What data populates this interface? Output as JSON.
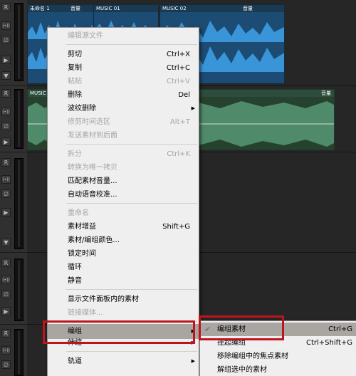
{
  "clips": {
    "clip1_name": "未命名 1",
    "clip1_vol": "音量",
    "clip2_name": "MUSIC 01",
    "clip2_vol": "音量",
    "clip3_name": "MUSIC 02",
    "clip3_vol": "音量",
    "clip4_name": "MUSIC",
    "clip4_vol": "音量"
  },
  "track_buttons": {
    "r": "R",
    "ro": "(•))",
    "phase": "∅"
  },
  "context_menu": {
    "items": [
      {
        "label": "编辑源文件",
        "shortcut": "",
        "disabled": true
      },
      {
        "label": "剪切",
        "shortcut": "Ctrl+X",
        "disabled": false
      },
      {
        "label": "复制",
        "shortcut": "Ctrl+C",
        "disabled": false
      },
      {
        "label": "粘贴",
        "shortcut": "Ctrl+V",
        "disabled": true
      },
      {
        "label": "删除",
        "shortcut": "Del",
        "disabled": false
      },
      {
        "label": "波纹删除",
        "shortcut": "",
        "disabled": false,
        "submenu": true
      },
      {
        "label": "修剪时间选区",
        "shortcut": "Alt+T",
        "disabled": true
      },
      {
        "label": "发送素材到后面",
        "shortcut": "",
        "disabled": true
      },
      {
        "label": "拆分",
        "shortcut": "Ctrl+K",
        "disabled": true
      },
      {
        "label": "转换为唯一拷贝",
        "shortcut": "",
        "disabled": true
      },
      {
        "label": "匹配素材音量...",
        "shortcut": "",
        "disabled": false
      },
      {
        "label": "自动语音校准...",
        "shortcut": "",
        "disabled": false
      },
      {
        "label": "重命名",
        "shortcut": "",
        "disabled": true
      },
      {
        "label": "素材增益",
        "shortcut": "Shift+G",
        "disabled": false
      },
      {
        "label": "素材/编组颜色...",
        "shortcut": "",
        "disabled": false
      },
      {
        "label": "锁定时间",
        "shortcut": "",
        "disabled": false
      },
      {
        "label": "循环",
        "shortcut": "",
        "disabled": false
      },
      {
        "label": "静音",
        "shortcut": "",
        "disabled": false
      },
      {
        "label": "显示文件面板内的素材",
        "shortcut": "",
        "disabled": false
      },
      {
        "label": "链接媒体...",
        "shortcut": "",
        "disabled": true
      },
      {
        "label": "编组",
        "shortcut": "",
        "disabled": false,
        "submenu": true,
        "highlighted": true
      },
      {
        "label": "伸缩",
        "shortcut": "",
        "disabled": false,
        "submenu": true
      },
      {
        "label": "轨道",
        "shortcut": "",
        "disabled": false,
        "submenu": true
      }
    ]
  },
  "submenu": {
    "items": [
      {
        "label": "编组素材",
        "shortcut": "Ctrl+G",
        "checked": true,
        "highlighted": true
      },
      {
        "label": "挂起编组",
        "shortcut": "Ctrl+Shift+G",
        "checked": false
      },
      {
        "label": "移除编组中的焦点素材",
        "shortcut": "",
        "checked": false
      },
      {
        "label": "解组选中的素材",
        "shortcut": "",
        "checked": false
      }
    ]
  },
  "colors": {
    "menu_bg": "#efefef",
    "highlight": "#a9a5a0",
    "annotation_red": "#c0131b",
    "clip_blue": "#2a7fc4",
    "clip_green": "#3f7258"
  },
  "icons": [
    "submenu-arrow-icon",
    "checkmark-icon"
  ]
}
